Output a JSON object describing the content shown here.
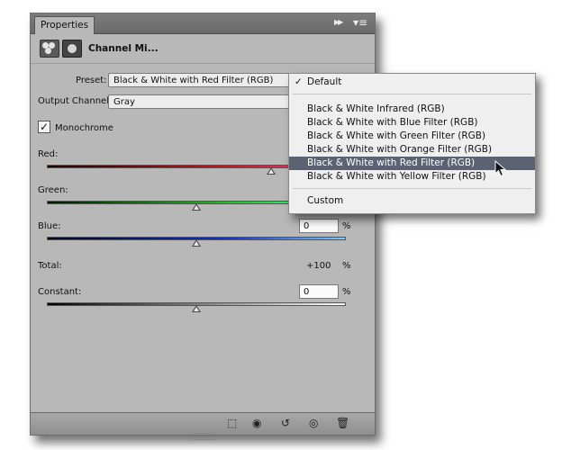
{
  "panel": {
    "tab_label": "Properties",
    "title": "Channel Mi...",
    "preset_label": "Preset:",
    "preset_value": "Black & White with Red Filter (RGB)",
    "output_label": "Output Channel:",
    "output_value": "Gray",
    "monochrome_label": "Monochrome",
    "monochrome_checked": true,
    "red": {
      "label": "Red:",
      "slider": 0.75
    },
    "green": {
      "label": "Green:",
      "slider": 0.5
    },
    "blue": {
      "label": "Blue:",
      "value": "0",
      "unit": "%",
      "slider": 0.5
    },
    "total": {
      "label": "Total:",
      "value": "+100",
      "unit": "%"
    },
    "constant": {
      "label": "Constant:",
      "value": "0",
      "unit": "%",
      "slider": 0.5
    }
  },
  "dropdown": {
    "items": [
      {
        "label": "Default",
        "checked": true
      },
      {
        "label": "Black & White Infrared (RGB)"
      },
      {
        "label": "Black & White with Blue Filter (RGB)"
      },
      {
        "label": "Black & White with Green Filter (RGB)"
      },
      {
        "label": "Black & White with Orange Filter (RGB)"
      },
      {
        "label": "Black & White with Red Filter (RGB)",
        "highlighted": true
      },
      {
        "label": "Black & White with Yellow Filter (RGB)"
      },
      {
        "label": "Custom"
      }
    ]
  },
  "icons": {
    "adjustment": "channel-mixer-icon",
    "mask": "layer-mask-icon",
    "footer": [
      "clip-to-layer-icon",
      "view-previous-icon",
      "reset-icon",
      "visibility-icon",
      "trash-icon"
    ]
  },
  "colors": {
    "panel_bg": "#b8b8b8",
    "menu_highlight": "#5c6271",
    "red_track_start": "#1a0000",
    "red_track_end": "#ff3c8c"
  }
}
